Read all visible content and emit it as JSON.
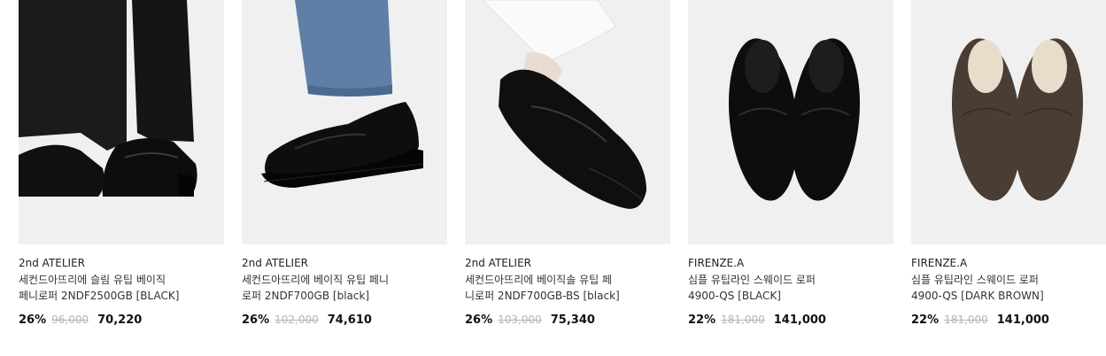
{
  "products": [
    {
      "brand": "2nd ATELIER",
      "name_line1": "세컨드아뜨리에 슬림 유팁 베이직",
      "name_line2": "페니로퍼 2NDF2500GB [BLACK]",
      "discount": "26%",
      "original_price": "96,000",
      "sale_price": "70,220",
      "image": "black-penny-loafer-worn-with-black-trousers"
    },
    {
      "brand": "2nd ATELIER",
      "name_line1": "세컨드아뜨리에 베이직 유팁 페니",
      "name_line2": "로퍼 2NDF700GB [black]",
      "discount": "26%",
      "original_price": "102,000",
      "sale_price": "74,610",
      "image": "black-lug-sole-penny-loafer-worn-with-jeans"
    },
    {
      "brand": "2nd ATELIER",
      "name_line1": "세컨드아뜨리에 베이직솔 유팁 페",
      "name_line2": "니로퍼 2NDF700GB-BS [black]",
      "discount": "26%",
      "original_price": "103,000",
      "sale_price": "75,340",
      "image": "black-penny-loafer-worn-with-white-trousers"
    },
    {
      "brand": "FIRENZE.A",
      "name_line1": "심플 유팁라인 스웨이드 로퍼",
      "name_line2": "4900-QS [BLACK]",
      "discount": "22%",
      "original_price": "181,000",
      "sale_price": "141,000",
      "image": "black-suede-loafer-pair-top-view"
    },
    {
      "brand": "FIRENZE.A",
      "name_line1": "심플 유팁라인 스웨이드 로퍼",
      "name_line2": "4900-QS [DARK BROWN]",
      "discount": "22%",
      "original_price": "181,000",
      "sale_price": "141,000",
      "image": "dark-brown-suede-loafer-pair-top-view"
    }
  ]
}
